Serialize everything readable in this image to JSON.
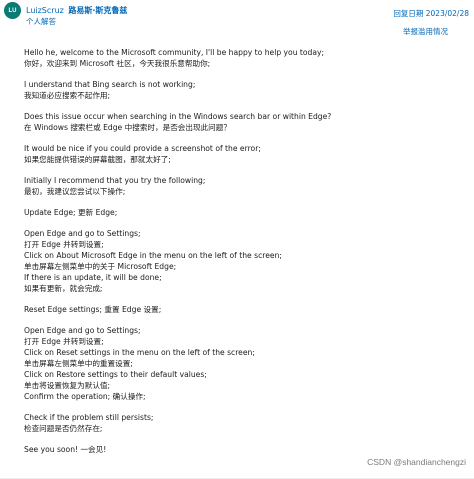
{
  "header": {
    "avatar_initials": "LU",
    "username": "LuizScruz",
    "role": "路易斯·斯克鲁兹",
    "profile_link": "个人解答",
    "reply_date": "回复日期 2023/02/28",
    "report_link": "举报滥用情况"
  },
  "body": {
    "blocks": [
      [
        "Hello he, welcome to the Microsoft community, I'll be happy to help you today;",
        "你好，欢迎来到 Microsoft 社区，今天我很乐意帮助你;"
      ],
      [
        "I understand that Bing search is not working;",
        "我知道必应搜索不起作用;"
      ],
      [
        "Does this issue occur when searching in the Windows search bar or within Edge?",
        "在 Windows 搜索栏或 Edge 中搜索时，是否会出现此问题？"
      ],
      [
        "It would be nice if you could provide a screenshot of the error;",
        "如果您能提供错误的屏幕截图，那就太好了;"
      ],
      [
        "Initially I recommend that you try the following;",
        "最初，我建议您尝试以下操作;"
      ],
      [
        "Update Edge;  更新 Edge;"
      ],
      [
        "Open Edge and go to Settings;",
        "打开 Edge 并转到设置;",
        "Click on About Microsoft Edge in the menu on the left of the screen;",
        "单击屏幕左侧菜单中的关于 Microsoft Edge;",
        "If there is an update, it will be done;",
        "如果有更新，就会完成;"
      ],
      [
        "Reset Edge settings;  重置 Edge 设置;"
      ],
      [
        "Open Edge and go to Settings;",
        "打开 Edge 并转到设置;",
        "Click on Reset settings in the menu on the left of the screen;",
        "单击屏幕左侧菜单中的重置设置;",
        "Click on Restore settings to their default values;",
        "单击将设置恢复为默认值;",
        "Confirm the operation;  确认操作;"
      ],
      [
        "Check if the problem still persists;",
        "检查问题是否仍然存在;"
      ],
      [
        "See you soon!  一会见!"
      ]
    ]
  },
  "watermark": "CSDN @shandianchengzi"
}
